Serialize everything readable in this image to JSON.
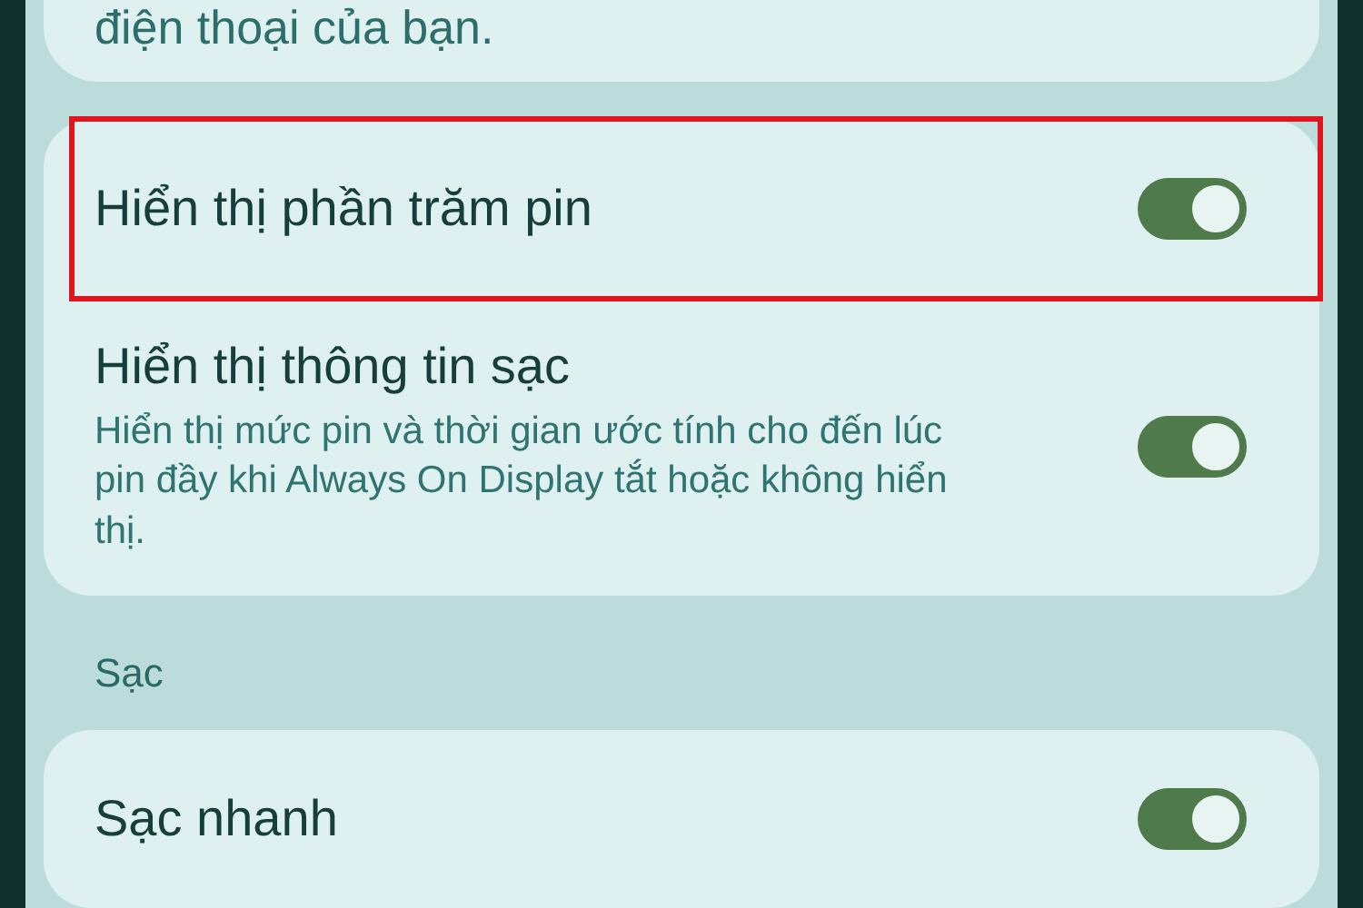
{
  "top_card": {
    "text": "điện thoại của bạn."
  },
  "display_settings": [
    {
      "title": "Hiển thị phần trăm pin",
      "on": true,
      "highlighted": true
    },
    {
      "title": "Hiển thị thông tin sạc",
      "description": "Hiển thị mức pin và thời gian ước tính cho đến lúc pin đầy khi Always On Display tắt hoặc không hiển thị.",
      "on": true,
      "highlighted": false
    }
  ],
  "charging_section": {
    "heading": "Sạc",
    "settings": [
      {
        "title": "Sạc nhanh",
        "on": true,
        "highlighted": false
      }
    ]
  }
}
